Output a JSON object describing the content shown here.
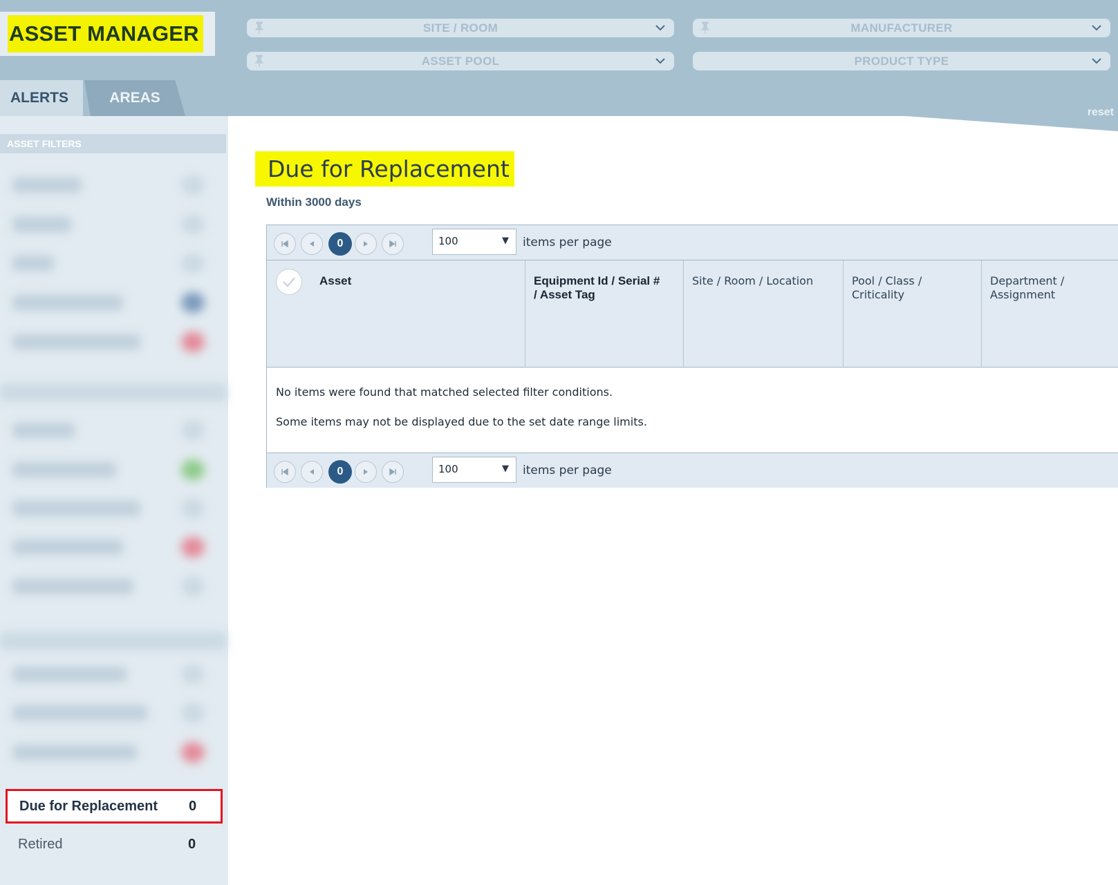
{
  "app": {
    "title": "ASSET MANAGER"
  },
  "filters": {
    "site_room": "SITE / ROOM",
    "manufacturer": "MANUFACTURER",
    "asset_pool": "ASSET POOL",
    "product_type": "PRODUCT TYPE",
    "reset": "reset"
  },
  "tabs": [
    {
      "label": "ALERTS",
      "active": true
    },
    {
      "label": "AREAS",
      "active": false
    }
  ],
  "sidebar": {
    "heading": "ASSET FILTERS",
    "items": [
      {
        "label": "Due for Replacement",
        "count": "0",
        "selected": true
      },
      {
        "label": "Retired",
        "count": "0",
        "selected": false
      }
    ]
  },
  "main": {
    "title": "Due for Replacement",
    "subtitle": "Within 3000 days",
    "pager": {
      "page": "0",
      "page_size": "100",
      "items_per_page_label": "items per page"
    },
    "columns": [
      "Asset",
      "Equipment Id / Serial # / Asset Tag",
      "Site / Room / Location",
      "Pool / Class / Criticality",
      "Department / Assignment"
    ],
    "columns_display": [
      [
        "Asset"
      ],
      [
        "Equipment Id / Serial #",
        "/ Asset Tag"
      ],
      [
        "Site / Room / Location"
      ],
      [
        "Pool / Class /",
        "Criticality"
      ],
      [
        "Department /",
        "Assignment"
      ]
    ],
    "empty_message": "No items were found that matched selected filter conditions.",
    "date_range_note": "Some items may not be displayed due to the set date range limits."
  },
  "colors": {
    "header_bg": "#a7c0cf",
    "highlight": "#f7f700",
    "selected_border": "#e3141f",
    "pager_active": "#2c5a86"
  }
}
